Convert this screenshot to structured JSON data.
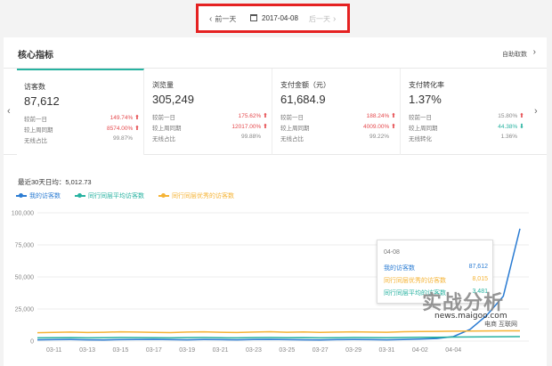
{
  "date_nav": {
    "prev_label": "前一天",
    "date": "2017-04-08",
    "next_label": "后一天"
  },
  "card": {
    "title": "核心指标",
    "custom_label": "自助取数"
  },
  "metrics": [
    {
      "name": "访客数",
      "value": "87,612",
      "rows": [
        {
          "label": "较前一日",
          "value": "149.74%",
          "trend": "up"
        },
        {
          "label": "较上周同期",
          "value": "8574.00%",
          "trend": "up"
        },
        {
          "label": "无线占比",
          "value": "99.87%",
          "trend": "none"
        }
      ]
    },
    {
      "name": "浏览量",
      "value": "305,249",
      "rows": [
        {
          "label": "较前一日",
          "value": "175.62%",
          "trend": "up"
        },
        {
          "label": "较上周同期",
          "value": "12017.00%",
          "trend": "up"
        },
        {
          "label": "无线占比",
          "value": "99.88%",
          "trend": "none"
        }
      ]
    },
    {
      "name": "支付金额（元）",
      "value": "61,684.9",
      "rows": [
        {
          "label": "较前一日",
          "value": "188.24%",
          "trend": "up"
        },
        {
          "label": "较上周同期",
          "value": "4009.00%",
          "trend": "up"
        },
        {
          "label": "无线占比",
          "value": "99.22%",
          "trend": "none"
        }
      ]
    },
    {
      "name": "支付转化率",
      "value": "1.37%",
      "rows": [
        {
          "label": "较前一日",
          "value": "15.80%",
          "trend": "up"
        },
        {
          "label": "较上周同期",
          "value": "44.38%",
          "trend": "down"
        },
        {
          "label": "无线转化",
          "value": "1.36%",
          "trend": "none"
        }
      ]
    }
  ],
  "colors": {
    "accent": "#27b2a0",
    "up": "#e5494d",
    "down": "#27b2a0",
    "series_mine": "#2b7cd3",
    "series_avg": "#27b2a0",
    "series_top": "#f5b335"
  },
  "chart_summary": "最近30天日均：5,012.73",
  "chart_data": {
    "type": "line",
    "x": [
      "03-10",
      "03-11",
      "03-12",
      "03-13",
      "03-14",
      "03-15",
      "03-16",
      "03-17",
      "03-18",
      "03-19",
      "03-20",
      "03-21",
      "03-22",
      "03-23",
      "03-24",
      "03-25",
      "03-26",
      "03-27",
      "03-28",
      "03-29",
      "03-30",
      "03-31",
      "04-01",
      "04-02",
      "04-03",
      "04-04",
      "04-05",
      "04-06",
      "04-07",
      "04-08"
    ],
    "xticks": [
      "03-11",
      "03-13",
      "03-15",
      "03-17",
      "03-19",
      "03-21",
      "03-23",
      "03-25",
      "03-27",
      "03-29",
      "03-31",
      "04-02",
      "04-04"
    ],
    "yticks": [
      0,
      25000,
      50000,
      75000,
      100000
    ],
    "ytick_labels": [
      "0",
      "25,000",
      "50,000",
      "75,000",
      "100,000"
    ],
    "ylim": [
      0,
      100000
    ],
    "series": [
      {
        "name": "我的访客数",
        "color": "#2b7cd3",
        "values": [
          1000,
          1100,
          1200,
          1000,
          900,
          1100,
          1200,
          1300,
          1100,
          1000,
          1200,
          1100,
          1000,
          1200,
          1300,
          1100,
          1000,
          900,
          1100,
          1200,
          1100,
          1000,
          1200,
          1500,
          2000,
          3500,
          9000,
          20000,
          35000,
          87612
        ]
      },
      {
        "name": "同行同层平均访客数",
        "color": "#27b2a0",
        "values": [
          2500,
          2600,
          2700,
          2500,
          2600,
          2800,
          2700,
          2600,
          2500,
          2700,
          2800,
          2600,
          2500,
          2700,
          2800,
          2600,
          2700,
          2500,
          2600,
          2800,
          2700,
          2600,
          2800,
          2900,
          3000,
          3100,
          3200,
          3300,
          3400,
          3481
        ]
      },
      {
        "name": "同行同层优秀的访客数",
        "color": "#f5b335",
        "values": [
          6500,
          6800,
          7000,
          6700,
          6900,
          7200,
          7000,
          6800,
          6600,
          7000,
          7200,
          6900,
          6700,
          7000,
          7300,
          6900,
          7100,
          6800,
          7000,
          7200,
          7000,
          6900,
          7300,
          7500,
          7600,
          7700,
          7800,
          7900,
          8000,
          8015
        ]
      }
    ]
  },
  "tooltip": {
    "date": "04-08",
    "rows": [
      {
        "name": "我的访客数",
        "value": "87,612",
        "color": "#2b7cd3"
      },
      {
        "name": "同行同层优秀的访客数",
        "value": "8,015",
        "color": "#f5b335"
      },
      {
        "name": "同行同层平均的访客数",
        "value": "3,481",
        "color": "#27b2a0"
      }
    ]
  },
  "watermark": {
    "main": "实战分析",
    "site": "news.maigoo.com",
    "sub": "电商 互联网"
  }
}
